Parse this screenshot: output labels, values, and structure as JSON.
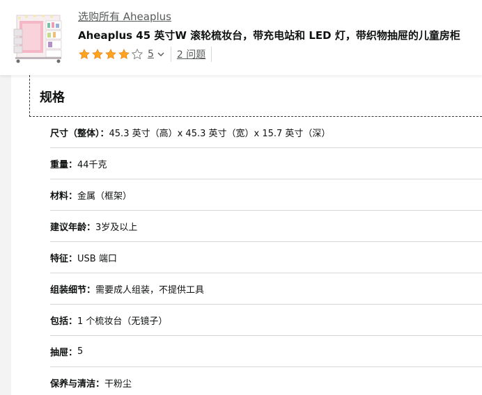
{
  "header": {
    "shop_link": "选购所有 Aheaplus",
    "product_title": "Aheaplus 45 英寸W 滚轮梳妆台，带充电站和 LED 灯，带织物抽屉的儿童房柜",
    "rating": {
      "value": "5",
      "stars_filled": 4,
      "stars_total": 5,
      "star_color": "#FFA41C"
    },
    "questions_link": "2 问题"
  },
  "specs": {
    "title": "规格",
    "items": [
      {
        "label": "尺寸（整体）：",
        "value": "45.3 英寸（高）x 45.3 英寸（宽）x 15.7 英寸（深）"
      },
      {
        "label": "重量：",
        "value": "44千克"
      },
      {
        "label": "材料：",
        "value": "金属（框架）"
      },
      {
        "label": "建议年龄：",
        "value": "3岁及以上"
      },
      {
        "label": "特征：",
        "value": "USB 端口"
      },
      {
        "label": "组装细节：",
        "value": "需要成人组装，不提供工具"
      },
      {
        "label": "包括：",
        "value": "1 个梳妆台（无镜子）"
      },
      {
        "label": "抽屉：",
        "value": "5"
      },
      {
        "label": "保养与清洁：",
        "value": "干粉尘"
      }
    ]
  },
  "icons": {
    "product_thumbnail": "vanity-table-image",
    "star": "star-icon",
    "chevron": "chevron-down-icon"
  }
}
